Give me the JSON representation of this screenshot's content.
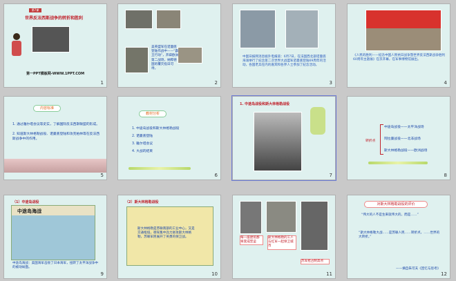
{
  "slides": [
    {
      "num": "1",
      "badge": "第7课",
      "title": "世界反法西斯战争的转折和胜利",
      "footer": "第一PPT模板网-WWW.1PPT.COM"
    },
    {
      "num": "2",
      "text": "美英盟军在诺曼底登陆作战中——“霸王行动”，开辟欧洲第二战场，纳粹德国的覆灭指日可待。"
    },
    {
      "num": "3",
      "text": "中国日报网消息据外电报道：6月7日，在法国西北部诺曼底海滩举行了纪念第二次世界大战盟军诺曼底登陆69周年的活动，各国老兵在内的嘉宾和各界人士参加了纪念活动。"
    },
    {
      "num": "4",
      "text": "《人民的胜利——纪念中国人民抗日战争暨世界反法西斯战争胜利60周年主题展》在京开幕，在军事博物馆展出。"
    },
    {
      "num": "5",
      "heading": "内容标准",
      "items": [
        "1. 通过雅尔塔会议等史实，了解国际反法西斯联盟的形成。",
        "2. 知道斯大林格勒战役、诺曼底登陆和攻克柏林等在反法西斯战争中的作用。"
      ]
    },
    {
      "num": "6",
      "heading": "教材分析",
      "items": [
        "1. 中途岛战役和斯大林格勒战役",
        "2. 诺曼底登陆",
        "3. 雅尔塔会议",
        "4. 大战的结束"
      ]
    },
    {
      "num": "7",
      "heading": "1. 中途岛战役和斯大林格勒战役"
    },
    {
      "num": "8",
      "label": "转折点",
      "items": [
        "中途岛战役——太平洋战场",
        "阿拉曼战役——北非战场",
        "斯大林格勒战役——欧洲战场"
      ]
    },
    {
      "num": "9",
      "heading": "（1）中途岛战役",
      "map_title": "中途岛海战",
      "caption": "中途岛海战：美国海军击败了日本海军，扭转了太平洋战争中的被动局面。"
    },
    {
      "num": "10",
      "heading": "（2）斯大林格勒战役",
      "note": "斯大林格勒是苏联南部的工业中心，又是交通枢纽，德军集中兵力进攻斯大林格勒，苏联军民展开了英勇的保卫战。"
    },
    {
      "num": "11",
      "cap1": "每一座建筑都将变成堡垒",
      "cap2": "斯大林格勒的工人与红军一起保卫城市",
      "cap3": "苏军抢占制高点"
    },
    {
      "num": "12",
      "heading": "对斯大林格勒战役的评价",
      "quote1": "“伟大的人不是生来就伟大的，而是……”",
      "quote2": "“斯大林格勒大战……是苏联人民……转折点，……世界的大转折。”",
      "sign": "——摘自朱可夫《回忆与思考》"
    }
  ]
}
